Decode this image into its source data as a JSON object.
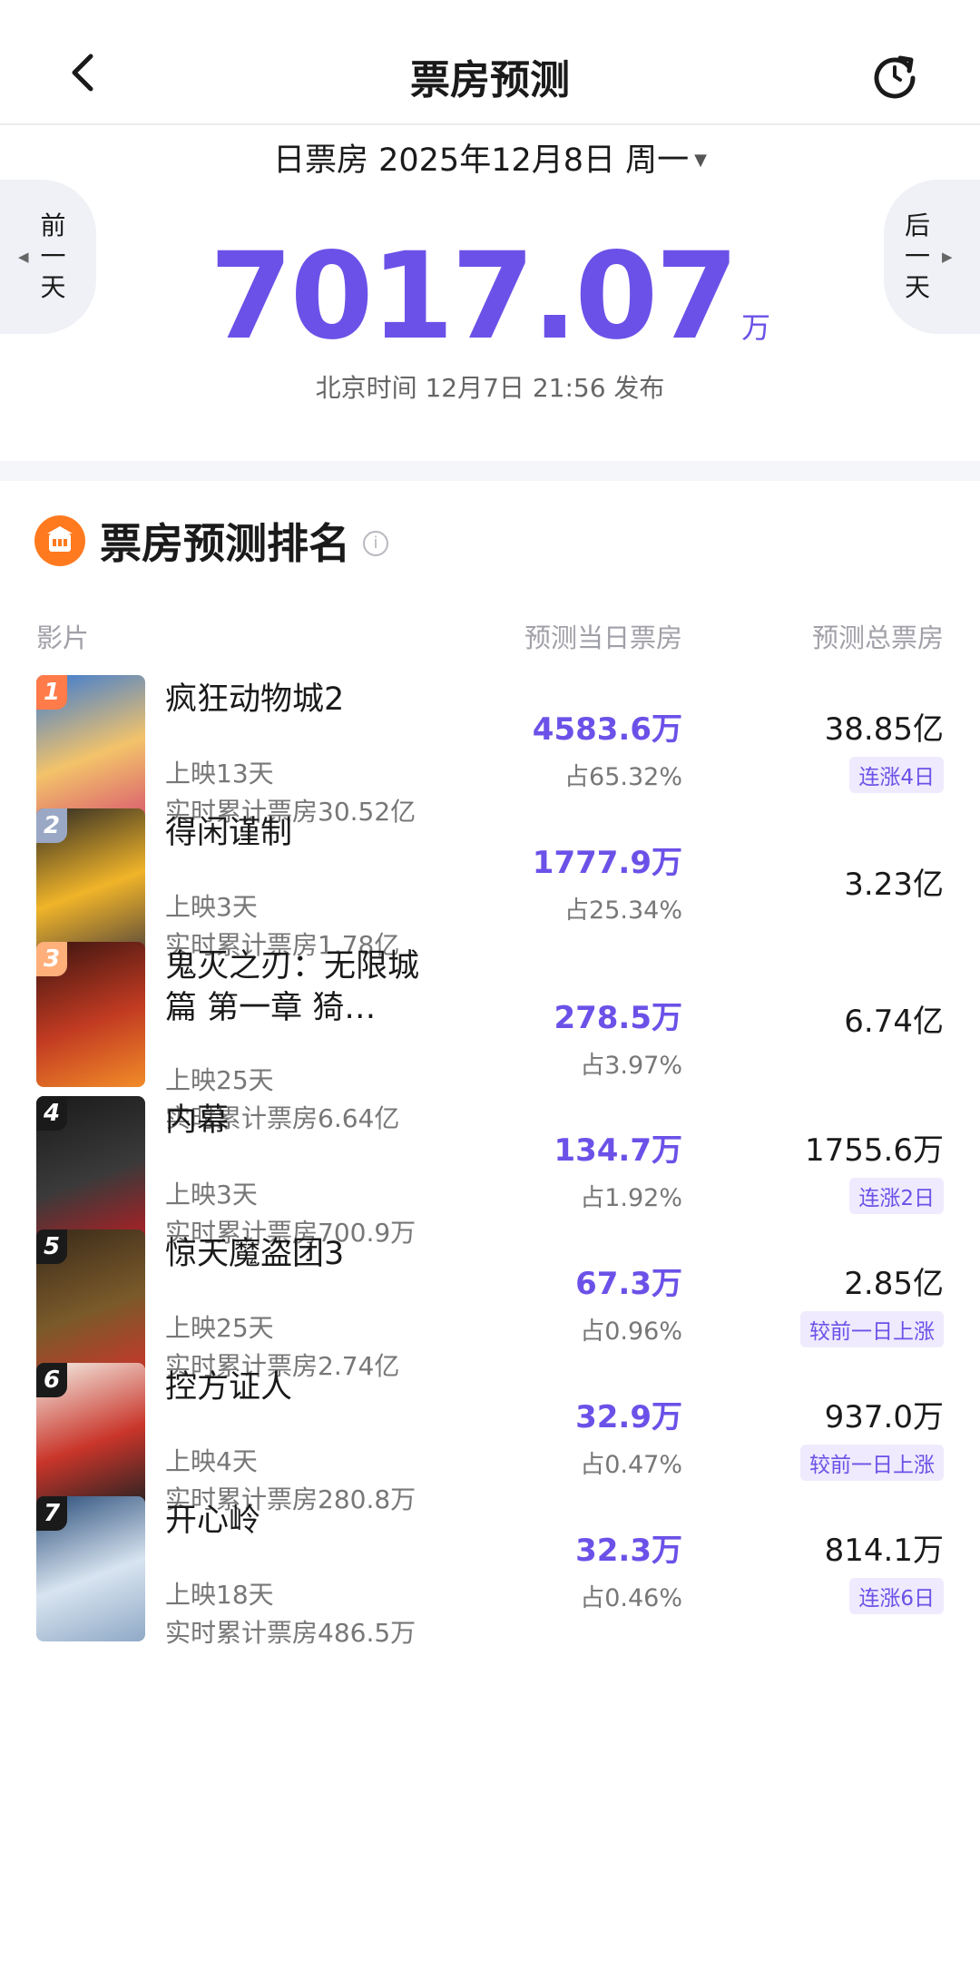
{
  "header": {
    "title": "票房预测"
  },
  "date_selector": {
    "label": "日票房 2025年12月8日 周一",
    "caret": "▼"
  },
  "nav": {
    "prev_label": "前一天",
    "next_label": "后一天"
  },
  "total": {
    "value": "7017.07",
    "unit": "万"
  },
  "publish_time": "北京时间 12月7日 21:56 发布",
  "ranking": {
    "title": "票房预测排名",
    "columns": {
      "film": "影片",
      "day": "预测当日票房",
      "total": "预测总票房"
    },
    "rows": [
      {
        "rank": "1",
        "name": "疯狂动物城2",
        "days": "上映13天",
        "cumulative": "实时累计票房30.52亿",
        "day_box": "4583.6万",
        "share": "占65.32%",
        "total_box": "38.85亿",
        "badge": "连涨4日",
        "badge_color": "#ff7b4a"
      },
      {
        "rank": "2",
        "name": "得闲谨制",
        "days": "上映3天",
        "cumulative": "实时累计票房1.78亿",
        "day_box": "1777.9万",
        "share": "占25.34%",
        "total_box": "3.23亿",
        "badge": "",
        "badge_color": "#9aa8c6"
      },
      {
        "rank": "3",
        "name": "鬼灭之刃：无限城篇 第一章 猗…",
        "days": "上映25天",
        "cumulative": "实时累计票房6.64亿",
        "day_box": "278.5万",
        "share": "占3.97%",
        "total_box": "6.74亿",
        "badge": "",
        "badge_color": "#ffb07a"
      },
      {
        "rank": "4",
        "name": "内幕",
        "days": "上映3天",
        "cumulative": "实时累计票房700.9万",
        "day_box": "134.7万",
        "share": "占1.92%",
        "total_box": "1755.6万",
        "badge": "连涨2日",
        "badge_color": "#1a1a1a"
      },
      {
        "rank": "5",
        "name": "惊天魔盗团3",
        "days": "上映25天",
        "cumulative": "实时累计票房2.74亿",
        "day_box": "67.3万",
        "share": "占0.96%",
        "total_box": "2.85亿",
        "badge": "较前一日上涨",
        "badge_color": "#1a1a1a"
      },
      {
        "rank": "6",
        "name": "控方证人",
        "days": "上映4天",
        "cumulative": "实时累计票房280.8万",
        "day_box": "32.9万",
        "share": "占0.47%",
        "total_box": "937.0万",
        "badge": "较前一日上涨",
        "badge_color": "#1a1a1a"
      },
      {
        "rank": "7",
        "name": "开心岭",
        "days": "上映18天",
        "cumulative": "实时累计票房486.5万",
        "day_box": "32.3万",
        "share": "占0.46%",
        "total_box": "814.1万",
        "badge": "连涨6日",
        "badge_color": "#1a1a1a"
      }
    ]
  },
  "colors": {
    "accent": "#6c51e8",
    "badge_bg": "#efeafd",
    "fire": "#ff7a1f"
  }
}
